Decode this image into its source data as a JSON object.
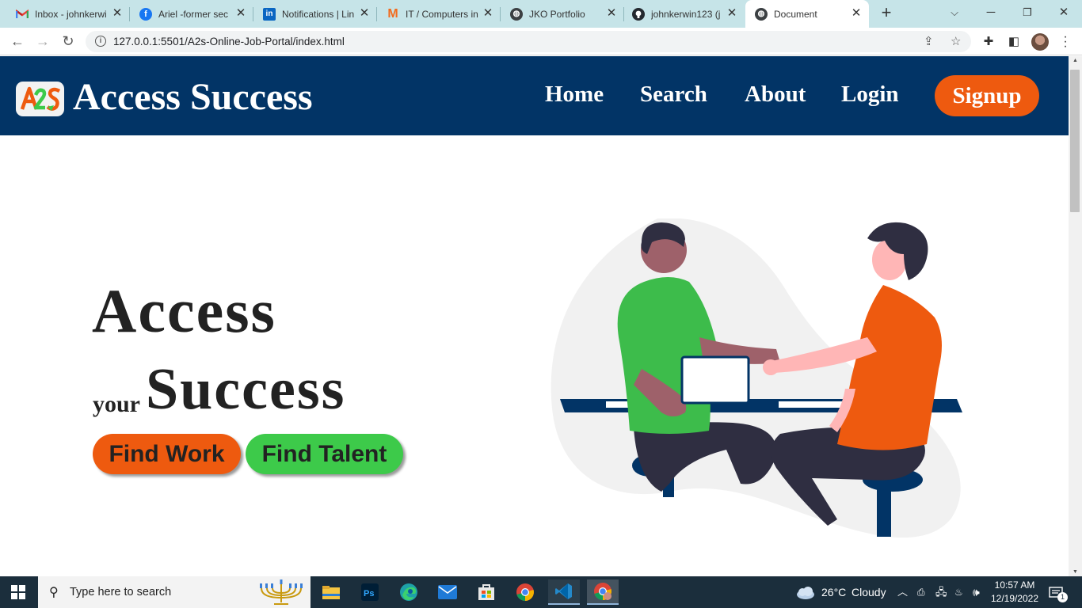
{
  "browser": {
    "tabs": [
      {
        "title": "Inbox - johnkerwi",
        "icon": "gmail-icon"
      },
      {
        "title": "Ariel -former sec",
        "icon": "facebook-icon"
      },
      {
        "title": "Notifications | Lin",
        "icon": "linkedin-icon"
      },
      {
        "title": "IT / Computers in",
        "icon": "m-logo-icon"
      },
      {
        "title": "JKO Portfolio",
        "icon": "globe-icon"
      },
      {
        "title": "johnkerwin123 (j",
        "icon": "github-icon"
      },
      {
        "title": "Document",
        "icon": "globe-icon",
        "active": true
      }
    ],
    "new_tab": "+",
    "url": "127.0.0.1:5501/A2s-Online-Job-Portal/index.html"
  },
  "site": {
    "logo_text": "A2S",
    "brand": "Access Success",
    "nav": {
      "home": "Home",
      "search": "Search",
      "about": "About",
      "login": "Login",
      "signup": "Signup"
    },
    "hero": {
      "line1": "Access",
      "your": "your",
      "line2": "Success"
    },
    "buttons": {
      "find_work": "Find Work",
      "find_talent": "Find Talent"
    },
    "colors": {
      "navbar": "#023466",
      "accent_orange": "#ee5a0f",
      "accent_green": "#3dca4a"
    }
  },
  "taskbar": {
    "search_placeholder": "Type here to search",
    "weather": {
      "temp": "26°C",
      "condition": "Cloudy"
    },
    "time": "10:57 AM",
    "date": "12/19/2022",
    "notification_count": "1",
    "apps": [
      "file-explorer-icon",
      "photoshop-icon",
      "edge-icon",
      "mail-icon",
      "store-icon",
      "chrome-icon",
      "vscode-icon",
      "chrome-canary-icon"
    ]
  }
}
